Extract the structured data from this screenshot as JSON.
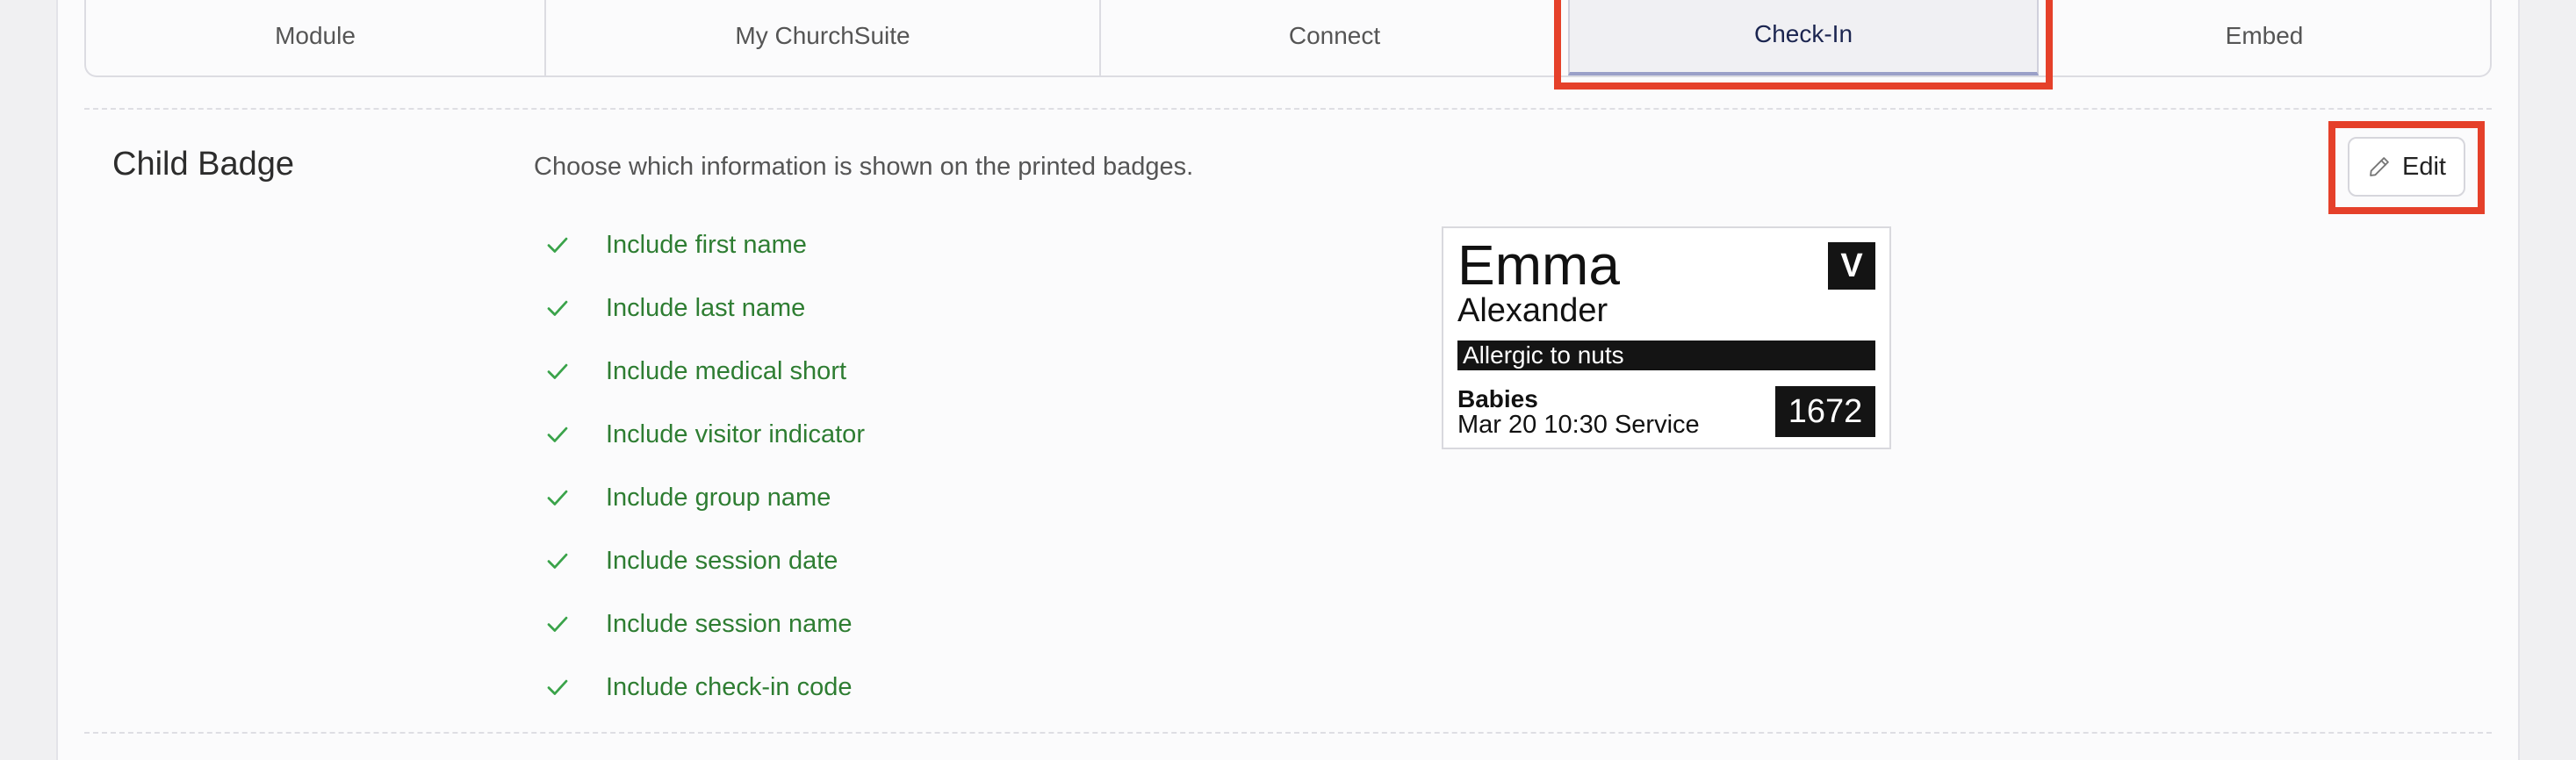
{
  "tabs": [
    {
      "label": "Module"
    },
    {
      "label": "My ChurchSuite"
    },
    {
      "label": "Connect"
    },
    {
      "label": "Check-In",
      "active": true
    },
    {
      "label": "Embed"
    }
  ],
  "section": {
    "title": "Child Badge",
    "description": "Choose which information is shown on the printed badges.",
    "edit_label": "Edit"
  },
  "options": [
    {
      "label": "Include first name",
      "checked": true
    },
    {
      "label": "Include last name",
      "checked": true
    },
    {
      "label": "Include medical short",
      "checked": true
    },
    {
      "label": "Include visitor indicator",
      "checked": true
    },
    {
      "label": "Include group name",
      "checked": true
    },
    {
      "label": "Include session date",
      "checked": true
    },
    {
      "label": "Include session name",
      "checked": true
    },
    {
      "label": "Include check-in code",
      "checked": true
    }
  ],
  "badge": {
    "first_name": "Emma",
    "last_name": "Alexander",
    "visitor_indicator": "V",
    "medical": "Allergic to nuts",
    "group": "Babies",
    "session": "Mar 20 10:30 Service",
    "code": "1672"
  },
  "colors": {
    "highlight": "#e5402a",
    "check": "#3aa34a",
    "option_text": "#2e7d32",
    "active_tab_text": "#1b2550"
  },
  "icons": {
    "edit": "pencil-icon",
    "option": "check-icon"
  }
}
